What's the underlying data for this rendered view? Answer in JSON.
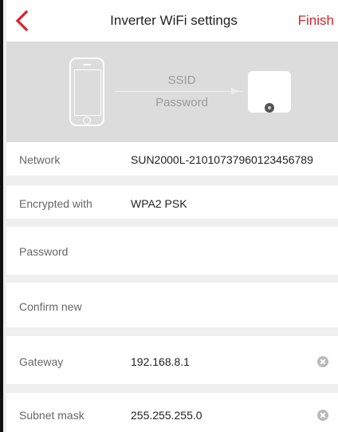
{
  "header": {
    "title": "Inverter WiFi settings",
    "finish_label": "Finish"
  },
  "banner": {
    "ssid_label": "SSID",
    "password_label": "Password"
  },
  "fields": {
    "network": {
      "label": "Network",
      "value": "SUN2000L-21010737960123456789"
    },
    "encryption": {
      "label": "Encrypted with",
      "value": "WPA2 PSK"
    },
    "password": {
      "label": "Password",
      "value": ""
    },
    "confirm": {
      "label": "Confirm new",
      "value": ""
    },
    "gateway": {
      "label": "Gateway",
      "value": "192.168.8.1"
    },
    "subnet": {
      "label": "Subnet mask",
      "value": "255.255.255.0"
    }
  },
  "colors": {
    "accent": "#d6242c",
    "banner_bg": "#dcdcdc",
    "page_bg": "#efefef"
  }
}
